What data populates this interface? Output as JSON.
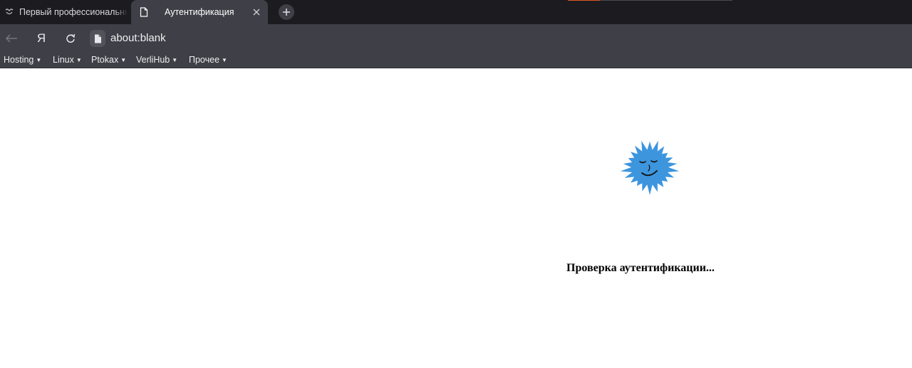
{
  "browser": {
    "tabs": [
      {
        "title": "Первый профессиональный",
        "active": false
      },
      {
        "title": "Аутентификация",
        "active": true
      }
    ],
    "address": "about:blank",
    "home_logo": "Я",
    "icons": {
      "back": "arrow-left-icon",
      "reload": "reload-icon",
      "page": "page-icon",
      "close": "close-icon",
      "new_tab": "plus-icon"
    }
  },
  "bookmarks": [
    {
      "label": "Hosting"
    },
    {
      "label": "Linux"
    },
    {
      "label": "Ptokax"
    },
    {
      "label": "VerliHub"
    },
    {
      "label": "Прочее"
    }
  ],
  "page": {
    "status_text": "Проверка аутентификации...",
    "mascot_color": "#3d95de"
  },
  "colors": {
    "tabstrip": "#1c1c20",
    "toolbar": "#3f3f47",
    "accent": "#e0561e"
  }
}
